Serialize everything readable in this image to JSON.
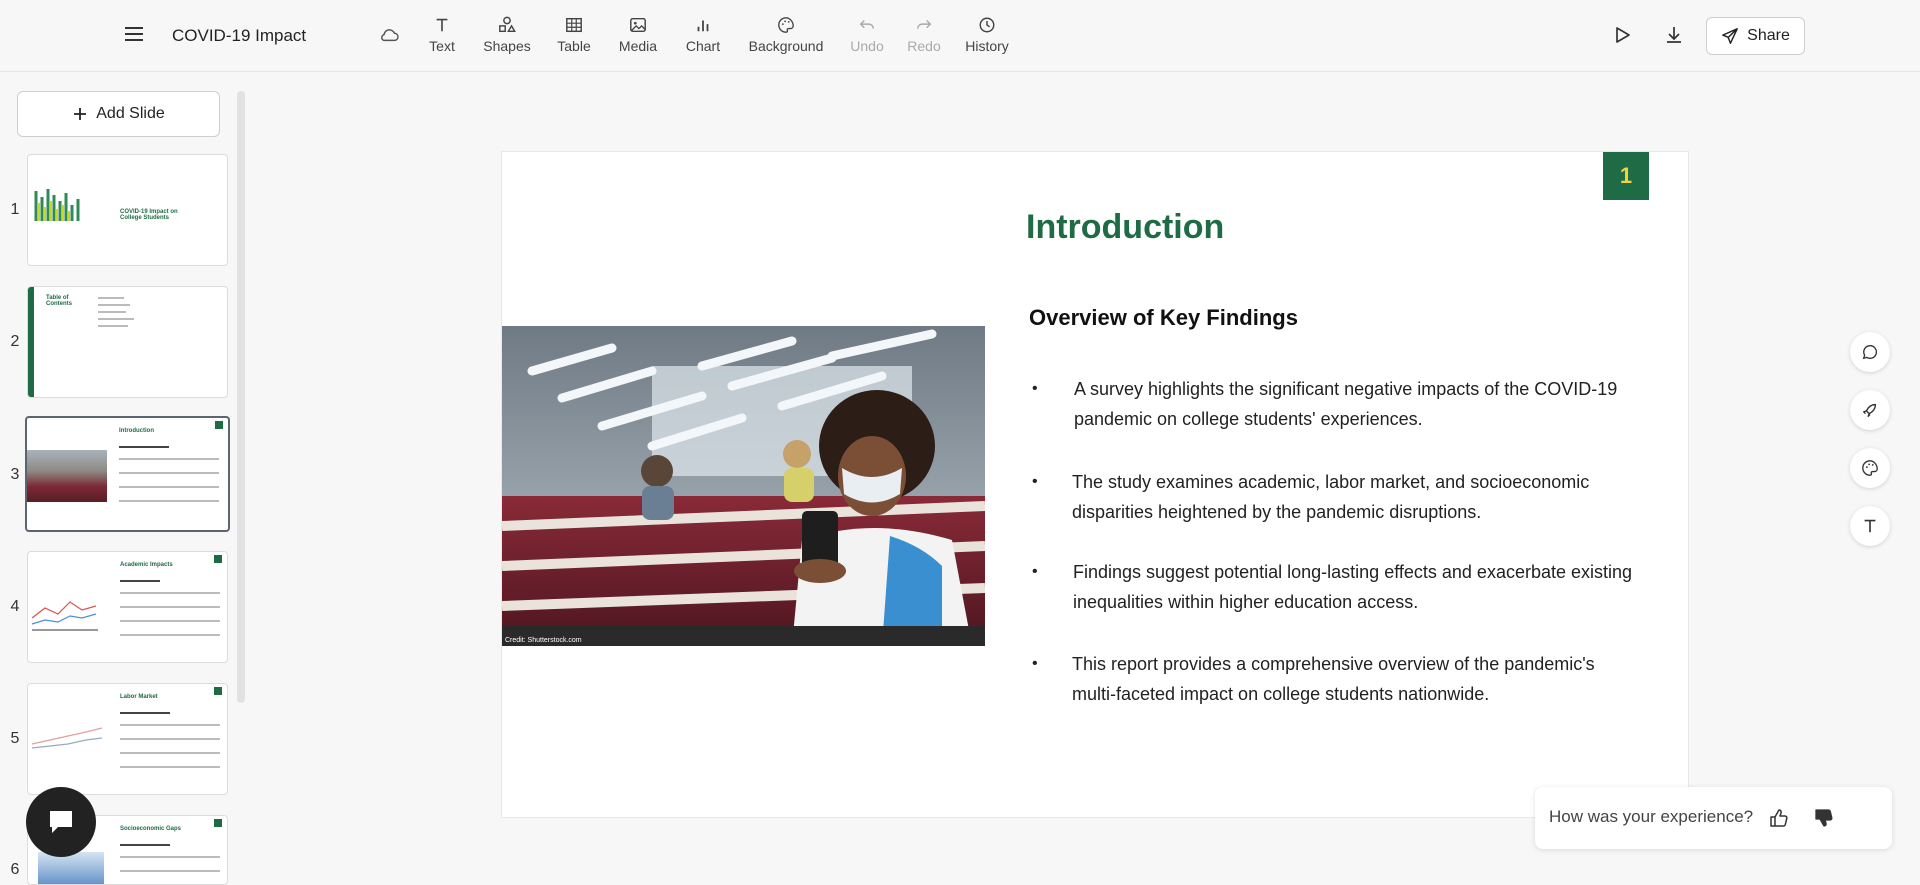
{
  "header": {
    "doc_title": "COVID-19 Impact",
    "tools": [
      {
        "label": "Text",
        "icon": "text-icon"
      },
      {
        "label": "Shapes",
        "icon": "shapes-icon"
      },
      {
        "label": "Table",
        "icon": "table-icon"
      },
      {
        "label": "Media",
        "icon": "media-icon"
      },
      {
        "label": "Chart",
        "icon": "chart-icon"
      },
      {
        "label": "Background",
        "icon": "palette-icon"
      },
      {
        "label": "Undo",
        "icon": "undo-icon"
      },
      {
        "label": "Redo",
        "icon": "redo-icon"
      },
      {
        "label": "History",
        "icon": "clock-icon"
      }
    ],
    "share_label": "Share"
  },
  "sidebar": {
    "add_slide_label": "Add Slide",
    "slides": [
      {
        "number": "1",
        "title": "COVID-19 Impact on College Students"
      },
      {
        "number": "2",
        "title": "Table of Contents"
      },
      {
        "number": "3",
        "title": "Introduction"
      },
      {
        "number": "4",
        "title": "Academic Impacts"
      },
      {
        "number": "5",
        "title": "Labor Market"
      },
      {
        "number": "6",
        "title": "Socioeconomic Gaps"
      }
    ]
  },
  "slide": {
    "badge": "1",
    "title": "Introduction",
    "subtitle": "Overview of Key Findings",
    "bullets": [
      {
        "bullet": "•",
        "line1": "A survey highlights the significant negative impacts of the COVID-19",
        "line2": "pandemic on college students' experiences."
      },
      {
        "bullet": "•",
        "line1": "The study examines academic, labor market, and socioeconomic",
        "line2": "disparities heightened by the pandemic disruptions."
      },
      {
        "bullet": "•",
        "line1": "Findings suggest potential long-lasting effects and exacerbate existing",
        "line2": "inequalities within higher education access."
      },
      {
        "bullet": "•",
        "line1": "This report provides a comprehensive overview of the pandemic's",
        "line2": "multi-faceted impact on college students nationwide."
      }
    ],
    "photo_credit": "Credit: Shutterstock.com"
  },
  "feedback": {
    "question": "How was your experience?"
  },
  "colors": {
    "accent": "#1e6b45",
    "badge_text": "#f3d33b"
  }
}
